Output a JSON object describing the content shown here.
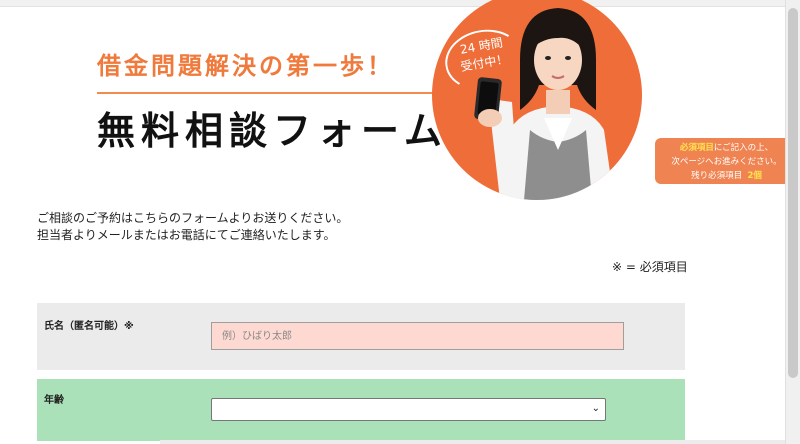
{
  "header": {
    "subtitle": "借金問題解決の第一歩！",
    "title": "無料相談フォーム",
    "badge_line1": "24 時間",
    "badge_line2": "受付中！"
  },
  "required_notice": {
    "highlight": "必須項目",
    "line1_rest": "にご記入の上、",
    "line2": "次ページへお進みください。",
    "remaining_label": "残り必須項目",
    "remaining_count": "2個"
  },
  "intro": {
    "line1": "ご相談のご予約はこちらのフォームよりお送りください。",
    "line2": "担当者よりメールまたはお電話にてご連絡いたします。"
  },
  "legend": "※ = 必須項目",
  "form": {
    "name_label": "氏名（匿名可能）",
    "name_required_mark": "※",
    "name_placeholder": "例）ひばり太郎",
    "age_label": "年齢",
    "age_selected": ""
  },
  "colors": {
    "accent_orange": "#ef7a3c",
    "required_row_bg": "#fdd9d1",
    "age_row_bg": "#abe1b9"
  }
}
